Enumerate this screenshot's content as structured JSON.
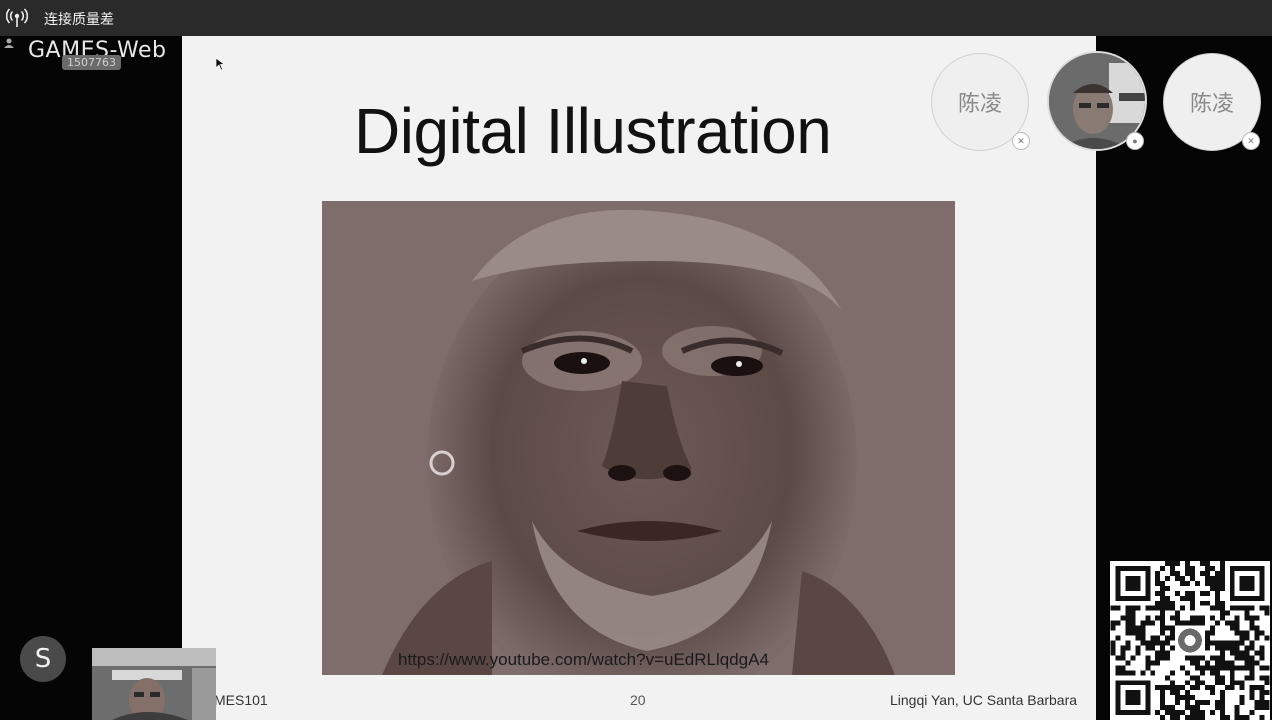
{
  "status_bar": {
    "connection_text": "连接质量差",
    "icon": "signal-broadcast-icon"
  },
  "watermark": {
    "text": "GAMES-Web",
    "room_id": "1507763"
  },
  "slide": {
    "title": "Digital Illustration",
    "url": "https://www.youtube.com/watch?v=uEdRLlqdgA4",
    "footer_left": "MES101",
    "page_number": "20",
    "footer_right": "Lingqi Yan, UC Santa Barbara"
  },
  "participants": [
    {
      "name": "陈凌",
      "type": "text-avatar"
    },
    {
      "name": "",
      "type": "camera-avatar"
    },
    {
      "name": "陈凌",
      "type": "text-avatar"
    }
  ],
  "bottom": {
    "logo_letter": "S"
  },
  "colors": {
    "slide_bg": "#f2f2f2",
    "photo_tone": "#7c6a68",
    "topbar_bg": "#2a2a2a"
  }
}
